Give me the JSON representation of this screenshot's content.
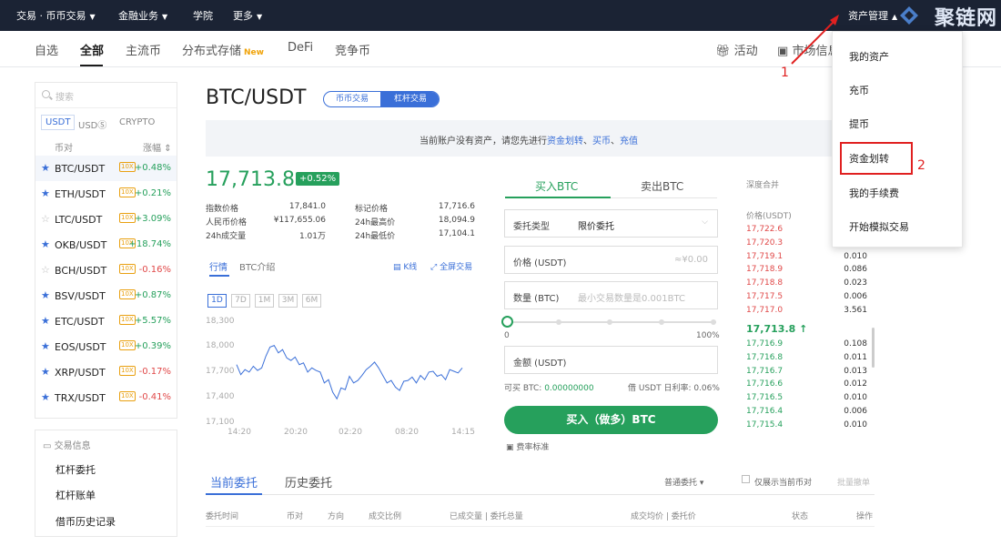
{
  "topnav": {
    "items": [
      "交易 · 币币交易",
      "金融业务",
      "学院",
      "更多"
    ],
    "asset_mgmt": "资产管理",
    "watermark": "聚链网"
  },
  "subnav": {
    "tabs": [
      "自选",
      "全部",
      "主流币",
      "分布式存储",
      "DeFi",
      "竞争币"
    ],
    "new_badge": "New",
    "activity": "活动",
    "market_info": "市场信息"
  },
  "dropdown": [
    "我的资产",
    "充币",
    "提币",
    "资金划转",
    "我的手续费",
    "开始模拟交易"
  ],
  "annotations": [
    "1",
    "2"
  ],
  "market": {
    "search_placeholder": "搜索",
    "quote_tabs": [
      "USDT",
      "USDⓈ",
      "CRYPTO"
    ],
    "col_pair": "币对",
    "col_change": "涨幅",
    "pairs": [
      {
        "name": "BTC/USDT",
        "lev": "10X",
        "change": "+0.48%",
        "fav": true
      },
      {
        "name": "ETH/USDT",
        "lev": "10X",
        "change": "+0.21%",
        "fav": true
      },
      {
        "name": "LTC/USDT",
        "lev": "10X",
        "change": "+3.09%",
        "fav": false
      },
      {
        "name": "OKB/USDT",
        "lev": "10X",
        "change": "+18.74%",
        "fav": true
      },
      {
        "name": "BCH/USDT",
        "lev": "10X",
        "change": "-0.16%",
        "fav": false
      },
      {
        "name": "BSV/USDT",
        "lev": "10X",
        "change": "+0.87%",
        "fav": true
      },
      {
        "name": "ETC/USDT",
        "lev": "10X",
        "change": "+5.57%",
        "fav": true
      },
      {
        "name": "EOS/USDT",
        "lev": "10X",
        "change": "+0.39%",
        "fav": true
      },
      {
        "name": "XRP/USDT",
        "lev": "10X",
        "change": "-0.17%",
        "fav": true
      },
      {
        "name": "TRX/USDT",
        "lev": "10X",
        "change": "-0.41%",
        "fav": true
      }
    ]
  },
  "info": {
    "heading": "交易信息",
    "links": [
      "杠杆委托",
      "杠杆账单",
      "借币历史记录"
    ]
  },
  "header": {
    "pair": "BTC/USDT",
    "mode_spot": "币币交易",
    "mode_margin": "杠杆交易"
  },
  "notice": {
    "prefix": "当前账户没有资产，请您先进行",
    "link1": "资金划转",
    "sep1": "、",
    "link2": "买币",
    "sep2": "、",
    "link3": "充值"
  },
  "ticker": {
    "price": "17,713.8",
    "change": "+0.52%",
    "stats": [
      {
        "label": "指数价格",
        "value": "17,841.0"
      },
      {
        "label": "标记价格",
        "value": "17,716.6"
      },
      {
        "label": "人民币价格",
        "value": "¥117,655.06"
      },
      {
        "label": "24h最高价",
        "value": "18,094.9"
      },
      {
        "label": "24h成交量",
        "value": "1.01万"
      },
      {
        "label": "24h最低价",
        "value": "17,104.1"
      }
    ]
  },
  "chart_tabs": [
    "行情",
    "BTC介绍"
  ],
  "chart_tools": [
    "K线",
    "全屏交易"
  ],
  "ranges": [
    "1D",
    "7D",
    "1M",
    "3M",
    "6M"
  ],
  "chart_data": {
    "type": "line",
    "x_ticks": [
      "14:20",
      "20:20",
      "02:20",
      "08:20",
      "14:15"
    ],
    "y_ticks": [
      "18,300",
      "18,000",
      "17,700",
      "17,400",
      "17,100"
    ],
    "ylim": [
      17100,
      18300
    ],
    "color": "#3a6fd8",
    "values": [
      17780,
      17660,
      17720,
      17690,
      17760,
      17710,
      17740,
      17880,
      17990,
      18010,
      17920,
      17960,
      17860,
      17830,
      17870,
      17780,
      17800,
      17690,
      17740,
      17710,
      17690,
      17560,
      17600,
      17450,
      17370,
      17500,
      17480,
      17640,
      17560,
      17590,
      17650,
      17720,
      17760,
      17810,
      17740,
      17650,
      17560,
      17590,
      17510,
      17470,
      17580,
      17590,
      17630,
      17560,
      17650,
      17600,
      17690,
      17700,
      17640,
      17660,
      17600,
      17720,
      17700,
      17680,
      17740
    ]
  },
  "order_form": {
    "tab_buy": "买入BTC",
    "tab_sell": "卖出BTC",
    "type_label": "委托类型",
    "type_value": "限价委托",
    "price_label": "价格 (USDT)",
    "price_hint": "≈¥0.00",
    "qty_label": "数量 (BTC)",
    "qty_placeholder": "最小交易数量是0.001BTC",
    "slider_min": "0",
    "slider_max": "100%",
    "amount_label": "金额 (USDT)",
    "available_label": "可买 BTC:",
    "available_value": "0.00000000",
    "rate_text": "借 USDT 日利率: 0.06%",
    "buy_button": "买入（做多）BTC",
    "fee_link": "费率标准"
  },
  "orderbook": {
    "depth_label": "深度合并",
    "price_label": "价格(USDT)",
    "asks": [
      {
        "p": "17,722.6",
        "q": ""
      },
      {
        "p": "17,720.3",
        "q": ""
      },
      {
        "p": "17,719.1",
        "q": "0.010"
      },
      {
        "p": "17,718.9",
        "q": "0.086"
      },
      {
        "p": "17,718.8",
        "q": "0.023"
      },
      {
        "p": "17,717.5",
        "q": "0.006"
      },
      {
        "p": "17,717.0",
        "q": "3.561"
      }
    ],
    "mid": "17,713.8 ↑",
    "bids": [
      {
        "p": "17,716.9",
        "q": "0.108"
      },
      {
        "p": "17,716.8",
        "q": "0.011"
      },
      {
        "p": "17,716.7",
        "q": "0.013"
      },
      {
        "p": "17,716.6",
        "q": "0.012"
      },
      {
        "p": "17,716.5",
        "q": "0.010"
      },
      {
        "p": "17,716.4",
        "q": "0.006"
      },
      {
        "p": "17,715.4",
        "q": "0.010"
      }
    ]
  },
  "orders": {
    "tab_current": "当前委托",
    "tab_history": "历史委托",
    "filter": "普通委托",
    "only_current": "仅展示当前币对",
    "cancel_all": "批量撤单",
    "columns": [
      "委托时间",
      "币对",
      "方向",
      "成交比例",
      "已成交量 | 委托总量",
      "成交均价 | 委托价",
      "状态",
      "操作"
    ]
  }
}
